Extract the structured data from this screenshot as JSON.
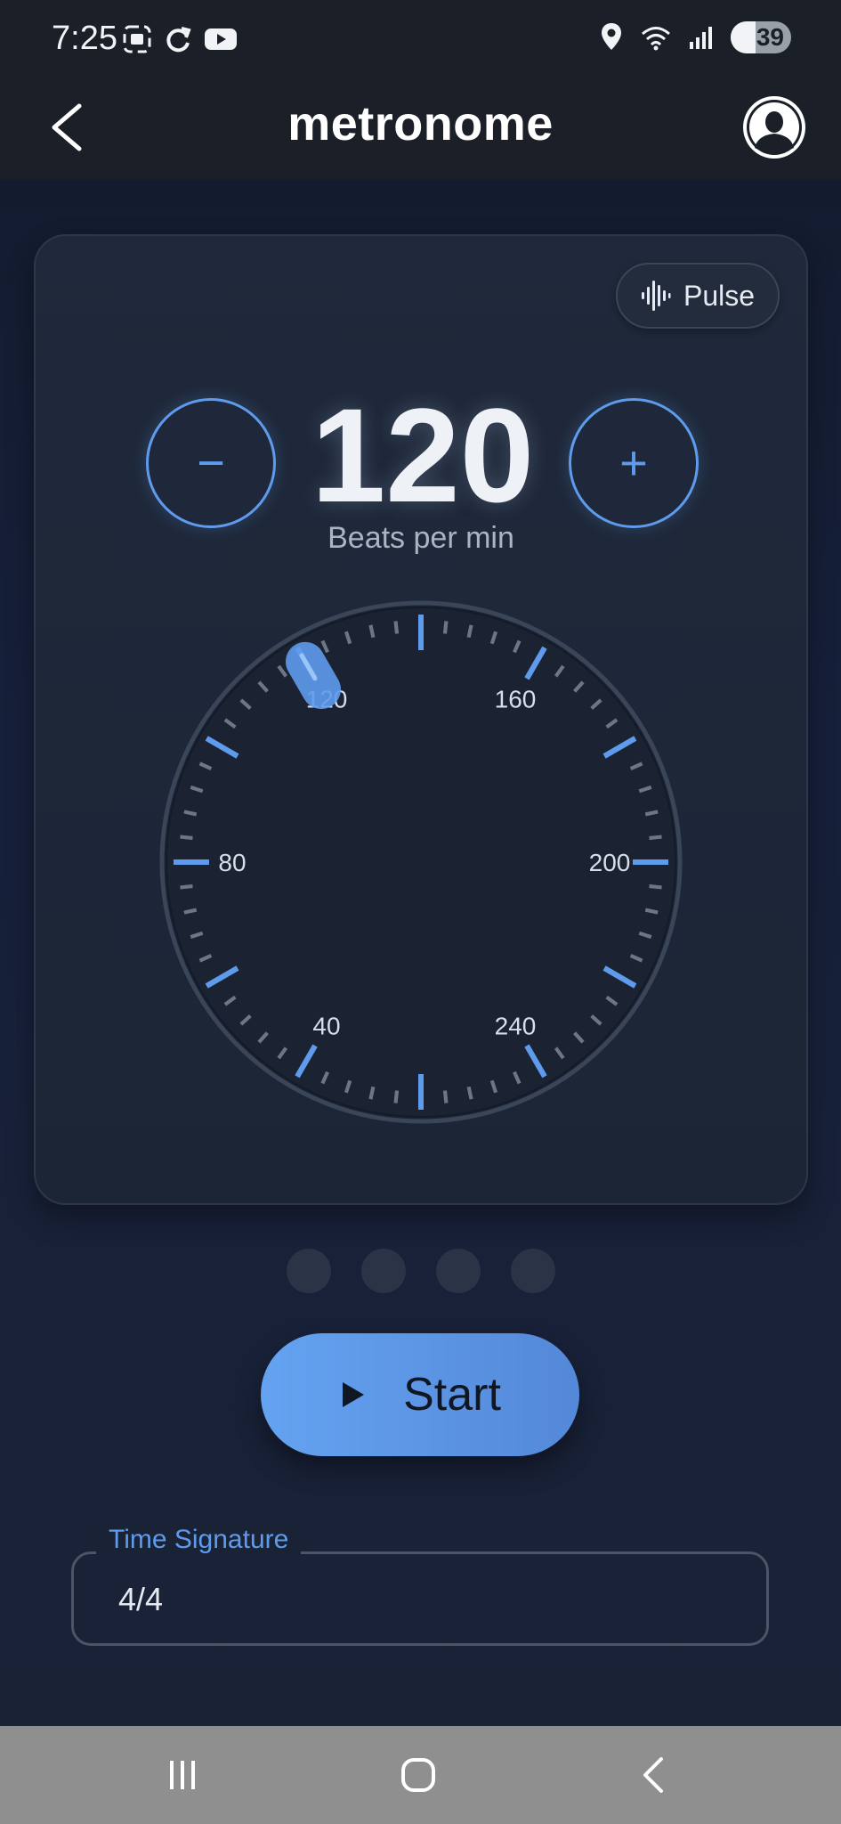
{
  "status_bar": {
    "time": "7:25",
    "battery": "39",
    "icons": [
      "screenshot-icon",
      "sync-icon",
      "youtube-icon",
      "location-icon",
      "wifi-icon",
      "signal-icon",
      "battery-icon"
    ]
  },
  "header": {
    "title": "metronome",
    "back_icon": "chevron-left-icon",
    "profile_icon": "profile-icon"
  },
  "dial_card": {
    "pulse_label": "Pulse",
    "bpm": "120",
    "bpm_label": "Beats per min",
    "minus_symbol": "−",
    "plus_symbol": "+",
    "dial": {
      "labels": [
        "40",
        "80",
        "120",
        "160",
        "200",
        "240"
      ],
      "min": 20,
      "max": 260,
      "current": 120
    }
  },
  "beat_dots": {
    "count": 4
  },
  "start_button": {
    "label": "Start"
  },
  "time_signature": {
    "label": "Time Signature",
    "value": "4/4"
  },
  "colors": {
    "accent": "#5f9bec",
    "background": "#16203a",
    "card": "#1f293b",
    "tick": "#6b7686"
  }
}
